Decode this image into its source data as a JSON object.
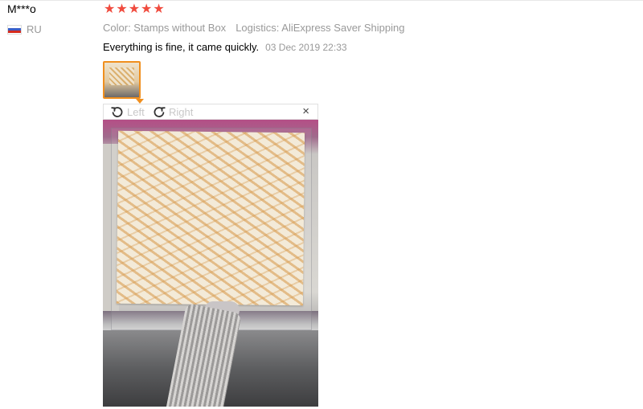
{
  "user": {
    "name": "M***o",
    "country_code": "RU",
    "flag_icon": "russia-flag-icon"
  },
  "review": {
    "rating": 5,
    "rating_max": 5,
    "star_color": "#f04b3e",
    "color_label": "Color: Stamps without Box",
    "logistics_label": "Logistics: AliExpress Saver Shipping",
    "text": "Everything is fine, it came quickly.",
    "date": "03 Dec 2019 22:33"
  },
  "viewer": {
    "rotate_left_label": "Left",
    "rotate_right_label": "Right",
    "close_symbol": "×",
    "active_border_color": "#f08f1e"
  }
}
